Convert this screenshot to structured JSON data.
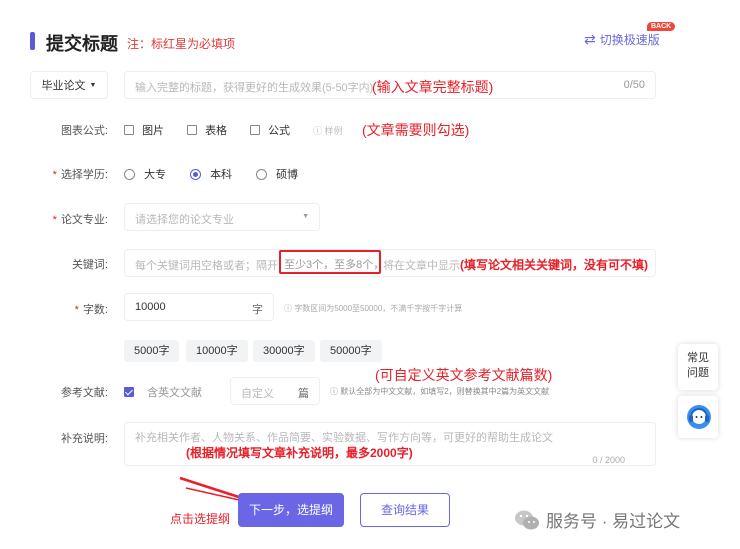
{
  "header": {
    "title": "提交标题",
    "note": "注：标红星为必填项",
    "switch_label": "切换极速版",
    "back_badge": "BACK"
  },
  "title_field": {
    "type_select": "毕业论文",
    "placeholder": "输入完整的标题，获得更好的生成效果(5-50字内)",
    "annotation": "(输入文章完整标题)",
    "counter": "0/50"
  },
  "charts_row": {
    "label": "图表公式:",
    "options": [
      "图片",
      "表格",
      "公式"
    ],
    "example": "样例",
    "annotation": "(文章需要则勾选)"
  },
  "degree_row": {
    "label": "选择学历:",
    "options": [
      "大专",
      "本科",
      "硕博"
    ],
    "selected": "本科"
  },
  "major_row": {
    "label": "论文专业:",
    "placeholder": "请选择您的论文专业"
  },
  "keywords_row": {
    "label": "关键词:",
    "placeholder_start": "每个关键词用空格或者；隔开，",
    "placeholder_highlight": "至少3个，至多8个，",
    "placeholder_end": "将在文章中显示",
    "annotation": "(填写论文相关关键词，没有可不填)"
  },
  "wordcount_row": {
    "label": "字数:",
    "value": "10000",
    "unit": "字",
    "hint": "字数区间为5000至50000，不满千字按千字计算",
    "presets": [
      "5000字",
      "10000字",
      "30000字",
      "50000字"
    ]
  },
  "references_row": {
    "label": "参考文献:",
    "checkbox_label": "含英文文献",
    "custom_placeholder": "自定义",
    "unit": "篇",
    "hint": "默认全部为中文文献，如填写2，则替换其中2篇为英文文献",
    "annotation": "(可自定义英文参考文献篇数)"
  },
  "notes_row": {
    "label": "补充说明:",
    "placeholder": "补充相关作者、人物关系、作品简要、实验数据、写作方向等，可更好的帮助生成论文",
    "annotation": "(根据情况填写文章补充说明，最多2000字)",
    "counter": "0 / 2000"
  },
  "actions": {
    "annotation": "点击选提纲",
    "next_label": "下一步，选提纲",
    "query_label": "查询结果"
  },
  "side": {
    "faq_label_1": "常见",
    "faq_label_2": "问题"
  },
  "watermark": {
    "text": "服务号 · 易过论文"
  },
  "colors": {
    "accent": "#6a66e6",
    "annotation_red": "#e8202a"
  }
}
